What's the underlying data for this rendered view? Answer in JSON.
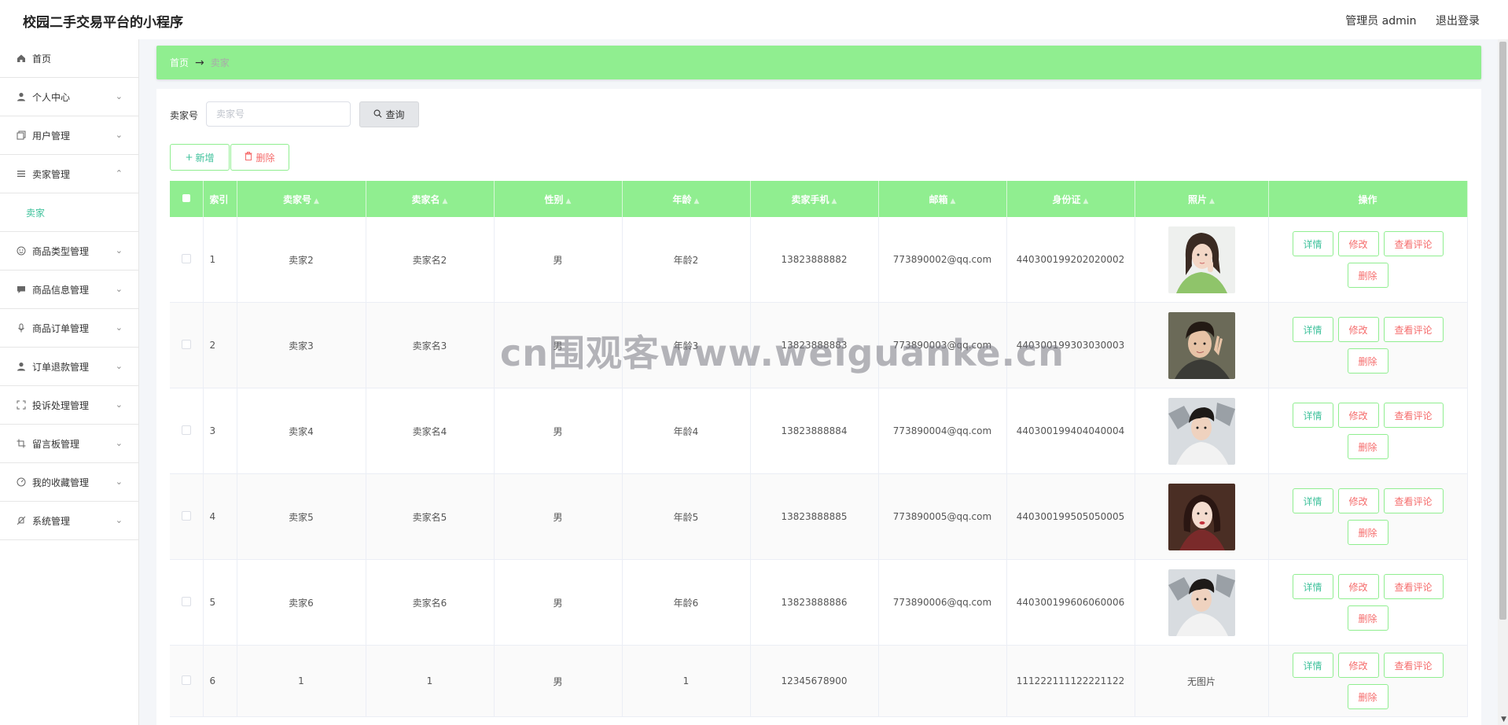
{
  "header": {
    "app_title": "校园二手交易平台的小程序",
    "admin_label": "管理员 admin",
    "logout_label": "退出登录"
  },
  "sidebar": {
    "items": [
      {
        "label": "首页",
        "icon": "home-icon"
      },
      {
        "label": "个人中心",
        "icon": "user-icon"
      },
      {
        "label": "用户管理",
        "icon": "copy-icon"
      },
      {
        "label": "卖家管理",
        "icon": "list-icon",
        "sub": "卖家"
      },
      {
        "label": "商品类型管理",
        "icon": "smile-icon"
      },
      {
        "label": "商品信息管理",
        "icon": "message-icon"
      },
      {
        "label": "商品订单管理",
        "icon": "microphone-icon"
      },
      {
        "label": "订单退款管理",
        "icon": "user-icon"
      },
      {
        "label": "投诉处理管理",
        "icon": "fullscreen-icon"
      },
      {
        "label": "留言板管理",
        "icon": "crop-icon"
      },
      {
        "label": "我的收藏管理",
        "icon": "odometer-icon"
      },
      {
        "label": "系统管理",
        "icon": "bell-off-icon"
      }
    ]
  },
  "breadcrumb": {
    "home": "首页",
    "arrow": "→",
    "current": "卖家"
  },
  "search": {
    "label": "卖家号",
    "placeholder": "卖家号",
    "query_label": "查询"
  },
  "actions": {
    "add_label": "新增",
    "delete_label": "删除"
  },
  "table": {
    "headers": [
      "索引",
      "卖家号",
      "卖家名",
      "性别",
      "年龄",
      "卖家手机",
      "邮箱",
      "身份证",
      "照片",
      "操作"
    ],
    "op_labels": {
      "detail": "详情",
      "edit": "修改",
      "review": "查看评论",
      "remove": "删除"
    },
    "rows": [
      {
        "index": "1",
        "seller_no": "卖家2",
        "seller_name": "卖家名2",
        "gender": "男",
        "age": "年龄2",
        "phone": "13823888882",
        "email": "773890002@qq.com",
        "id_card": "440300199202020002",
        "photo": "woman-green-sweater"
      },
      {
        "index": "2",
        "seller_no": "卖家3",
        "seller_name": "卖家名3",
        "gender": "男",
        "age": "年龄3",
        "phone": "13823888883",
        "email": "773890003@qq.com",
        "id_card": "440300199303030003",
        "photo": "man-peace-sign"
      },
      {
        "index": "3",
        "seller_no": "卖家4",
        "seller_name": "卖家名4",
        "gender": "男",
        "age": "年龄4",
        "phone": "13823888884",
        "email": "773890004@qq.com",
        "id_card": "440300199404040004",
        "photo": "man-white-jacket"
      },
      {
        "index": "4",
        "seller_no": "卖家5",
        "seller_name": "卖家名5",
        "gender": "男",
        "age": "年龄5",
        "phone": "13823888885",
        "email": "773890005@qq.com",
        "id_card": "440300199505050005",
        "photo": "woman-red-lips"
      },
      {
        "index": "5",
        "seller_no": "卖家6",
        "seller_name": "卖家名6",
        "gender": "男",
        "age": "年龄6",
        "phone": "13823888886",
        "email": "773890006@qq.com",
        "id_card": "440300199606060006",
        "photo": "man-white-jacket"
      },
      {
        "index": "6",
        "seller_no": "1",
        "seller_name": "1",
        "gender": "男",
        "age": "1",
        "phone": "12345678900",
        "email": "",
        "id_card": "111222111122221122",
        "photo_text": "无图片"
      }
    ]
  },
  "watermark": "cn围观客www.weiguanke.cn",
  "colors": {
    "accent": "#90ee90",
    "accent_text": "#3ec19b",
    "danger": "#f56c6c"
  }
}
